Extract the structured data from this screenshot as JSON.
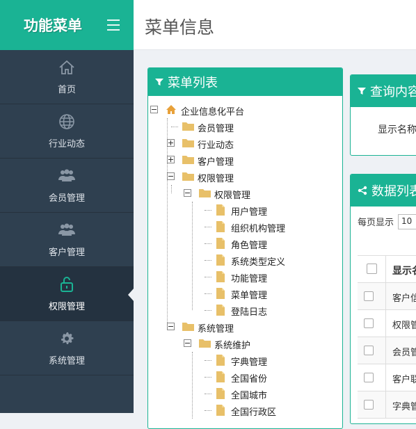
{
  "sidebar": {
    "title": "功能菜单",
    "items": [
      {
        "label": "首页",
        "icon": "home-icon"
      },
      {
        "label": "行业动态",
        "icon": "globe-icon"
      },
      {
        "label": "会员管理",
        "icon": "users-icon"
      },
      {
        "label": "客户管理",
        "icon": "users-icon"
      },
      {
        "label": "权限管理",
        "icon": "lock-icon",
        "active": true
      },
      {
        "label": "系统管理",
        "icon": "gear-icon"
      }
    ]
  },
  "header": {
    "title": "菜单信息"
  },
  "tree_panel": {
    "title": "菜单列表",
    "nodes": [
      {
        "label": "企业信息化平台",
        "level": 0,
        "toggle": "minus",
        "icon": "home-icon"
      },
      {
        "label": "会员管理",
        "level": 1,
        "toggle": "none",
        "icon": "folder-icon"
      },
      {
        "label": "行业动态",
        "level": 1,
        "toggle": "plus",
        "icon": "folder-icon"
      },
      {
        "label": "客户管理",
        "level": 1,
        "toggle": "plus",
        "icon": "folder-icon"
      },
      {
        "label": "权限管理",
        "level": 1,
        "toggle": "minus",
        "icon": "folder-icon"
      },
      {
        "label": "权限管理",
        "level": 2,
        "toggle": "minus",
        "icon": "folder-icon"
      },
      {
        "label": "用户管理",
        "level": 3,
        "toggle": "none",
        "icon": "file-icon"
      },
      {
        "label": "组织机构管理",
        "level": 3,
        "toggle": "none",
        "icon": "file-icon"
      },
      {
        "label": "角色管理",
        "level": 3,
        "toggle": "none",
        "icon": "file-icon"
      },
      {
        "label": "系统类型定义",
        "level": 3,
        "toggle": "none",
        "icon": "file-icon"
      },
      {
        "label": "功能管理",
        "level": 3,
        "toggle": "none",
        "icon": "file-icon"
      },
      {
        "label": "菜单管理",
        "level": 3,
        "toggle": "none",
        "icon": "file-icon"
      },
      {
        "label": "登陆日志",
        "level": 3,
        "toggle": "none",
        "icon": "file-icon"
      },
      {
        "label": "系统管理",
        "level": 1,
        "toggle": "minus",
        "icon": "folder-icon"
      },
      {
        "label": "系统维护",
        "level": 2,
        "toggle": "minus",
        "icon": "folder-icon"
      },
      {
        "label": "字典管理",
        "level": 3,
        "toggle": "none",
        "icon": "file-icon"
      },
      {
        "label": "全国省份",
        "level": 3,
        "toggle": "none",
        "icon": "file-icon"
      },
      {
        "label": "全国城市",
        "level": 3,
        "toggle": "none",
        "icon": "file-icon"
      },
      {
        "label": "全国行政区",
        "level": 3,
        "toggle": "none",
        "icon": "file-icon"
      }
    ]
  },
  "query_panel": {
    "title": "查询内容",
    "field_label": "显示名称"
  },
  "data_panel": {
    "title": "数据列表",
    "per_page_label": "每页显示",
    "per_page_value": "10",
    "header": "显示名称",
    "rows": [
      "客户信息",
      "权限管理",
      "会员管理",
      "客户联系",
      "字典管理"
    ]
  },
  "colors": {
    "accent": "#1ab394",
    "sidebar": "#2f4050",
    "folder": "#e8c069"
  }
}
